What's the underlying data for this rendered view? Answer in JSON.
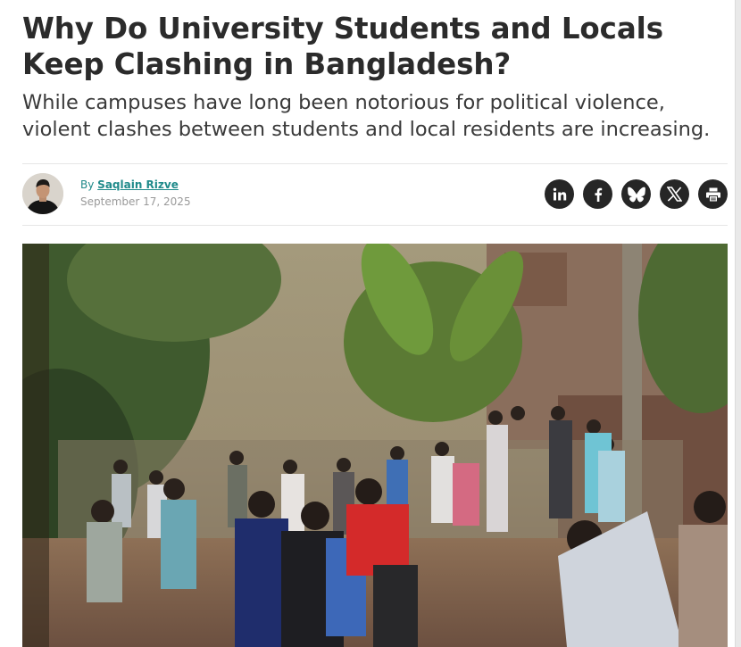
{
  "article": {
    "headline": "Why Do University Students and Locals Keep Clashing in Bangladesh?",
    "subheadline": "While campuses have long been notorious for political violence, violent clashes between students and local residents are increasing."
  },
  "byline": {
    "prefix": "By",
    "author": "Saqlain Rizve",
    "date": "September 17, 2025"
  },
  "share": {
    "items": [
      {
        "name": "linkedin",
        "icon": "linkedin-icon"
      },
      {
        "name": "facebook",
        "icon": "facebook-icon"
      },
      {
        "name": "bluesky",
        "icon": "bluesky-icon"
      },
      {
        "name": "x",
        "icon": "x-icon"
      },
      {
        "name": "print",
        "icon": "print-icon"
      }
    ]
  },
  "hero_image": {
    "subject": "photo"
  },
  "colors": {
    "link": "#1f8a8a",
    "share_button": "#262626",
    "headline": "#2b2b2b"
  }
}
